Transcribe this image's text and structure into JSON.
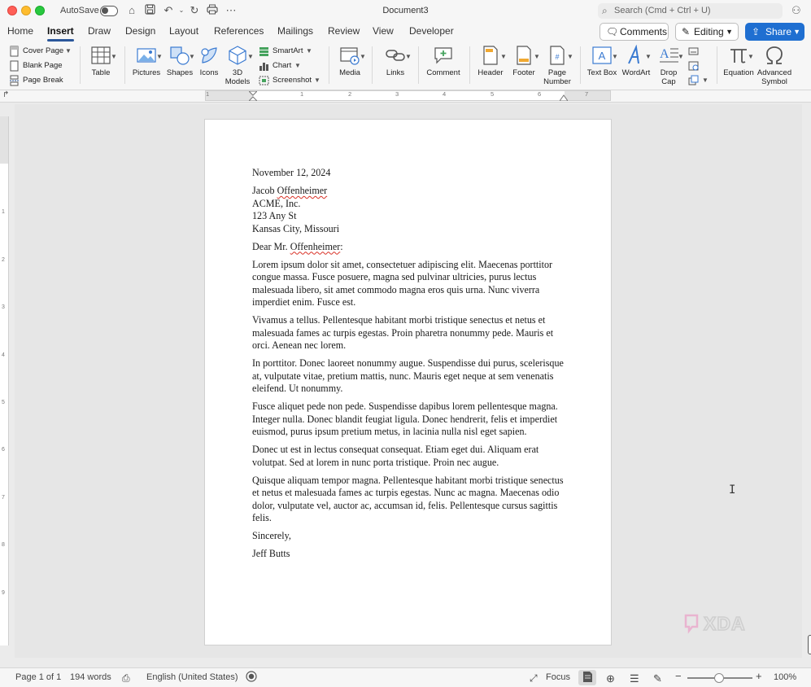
{
  "window": {
    "autosave_label": "AutoSave",
    "title": "Document3",
    "search_placeholder": "Search (Cmd + Ctrl + U)"
  },
  "tabs": [
    {
      "label": "Home"
    },
    {
      "label": "Insert"
    },
    {
      "label": "Draw"
    },
    {
      "label": "Design"
    },
    {
      "label": "Layout"
    },
    {
      "label": "References"
    },
    {
      "label": "Mailings"
    },
    {
      "label": "Review"
    },
    {
      "label": "View"
    },
    {
      "label": "Developer"
    }
  ],
  "active_tab": "Insert",
  "actions": {
    "comments": "Comments",
    "editing": "Editing",
    "share": "Share"
  },
  "ribbon": {
    "pages": [
      "Cover Page",
      "Blank Page",
      "Page Break"
    ],
    "table": "Table",
    "pictures": "Pictures",
    "shapes": "Shapes",
    "icons": "Icons",
    "models": "3D Models",
    "smartart": "SmartArt",
    "chart": "Chart",
    "screenshot": "Screenshot",
    "media": "Media",
    "links": "Links",
    "comment": "Comment",
    "header": "Header",
    "footer": "Footer",
    "page_number": "Page Number",
    "text_box": "Text Box",
    "wordart": "WordArt",
    "drop_cap": "Drop Cap",
    "equation": "Equation",
    "advanced_symbol": "Advanced Symbol"
  },
  "ruler": {
    "h_labels": [
      "1",
      "1",
      "2",
      "3",
      "4",
      "5",
      "6",
      "7"
    ],
    "v_labels": [
      "1",
      "2",
      "3",
      "4",
      "5",
      "6",
      "7",
      "8",
      "9"
    ]
  },
  "document": {
    "date": "November 12, 2024",
    "recipient_first": "Jacob",
    "recipient_last": "Offenheimer",
    "company": "ACME, Inc.",
    "street": "123 Any St",
    "city": "Kansas City, Missouri",
    "salutation_pre": "Dear Mr.",
    "salutation_name": "Offenheimer",
    "salutation_post": ":",
    "paragraphs": [
      "Lorem ipsum dolor sit amet, consectetuer adipiscing elit. Maecenas porttitor congue massa. Fusce posuere, magna sed pulvinar ultricies, purus lectus malesuada libero, sit amet commodo magna eros quis urna. Nunc viverra imperdiet enim. Fusce est.",
      "Vivamus a tellus. Pellentesque habitant morbi tristique senectus et netus et malesuada fames ac turpis egestas. Proin pharetra nonummy pede. Mauris et orci. Aenean nec lorem.",
      "In porttitor. Donec laoreet nonummy augue. Suspendisse dui purus, scelerisque at, vulputate vitae, pretium mattis, nunc. Mauris eget neque at sem venenatis eleifend. Ut nonummy.",
      "Fusce aliquet pede non pede. Suspendisse dapibus lorem pellentesque magna. Integer nulla. Donec blandit feugiat ligula. Donec hendrerit, felis et imperdiet euismod, purus ipsum pretium metus, in lacinia nulla nisl eget sapien.",
      "Donec ut est in lectus consequat consequat. Etiam eget dui. Aliquam erat volutpat. Sed at lorem in nunc porta tristique. Proin nec augue.",
      "Quisque aliquam tempor magna. Pellentesque habitant morbi tristique senectus et netus et malesuada fames ac turpis egestas. Nunc ac magna. Maecenas odio dolor, vulputate vel, auctor ac, accumsan id, felis. Pellentesque cursus sagittis felis."
    ],
    "closing": "Sincerely,",
    "signature": "Jeff Butts"
  },
  "watermark": "XDA",
  "status": {
    "page": "Page 1 of 1",
    "words": "194 words",
    "language": "English (United States)",
    "focus": "Focus",
    "zoom": "100%",
    "zoom_level": 1.0
  },
  "colors": {
    "accent": "#2b579a",
    "share": "#1f6fd1",
    "spell_error": "#d93025"
  }
}
